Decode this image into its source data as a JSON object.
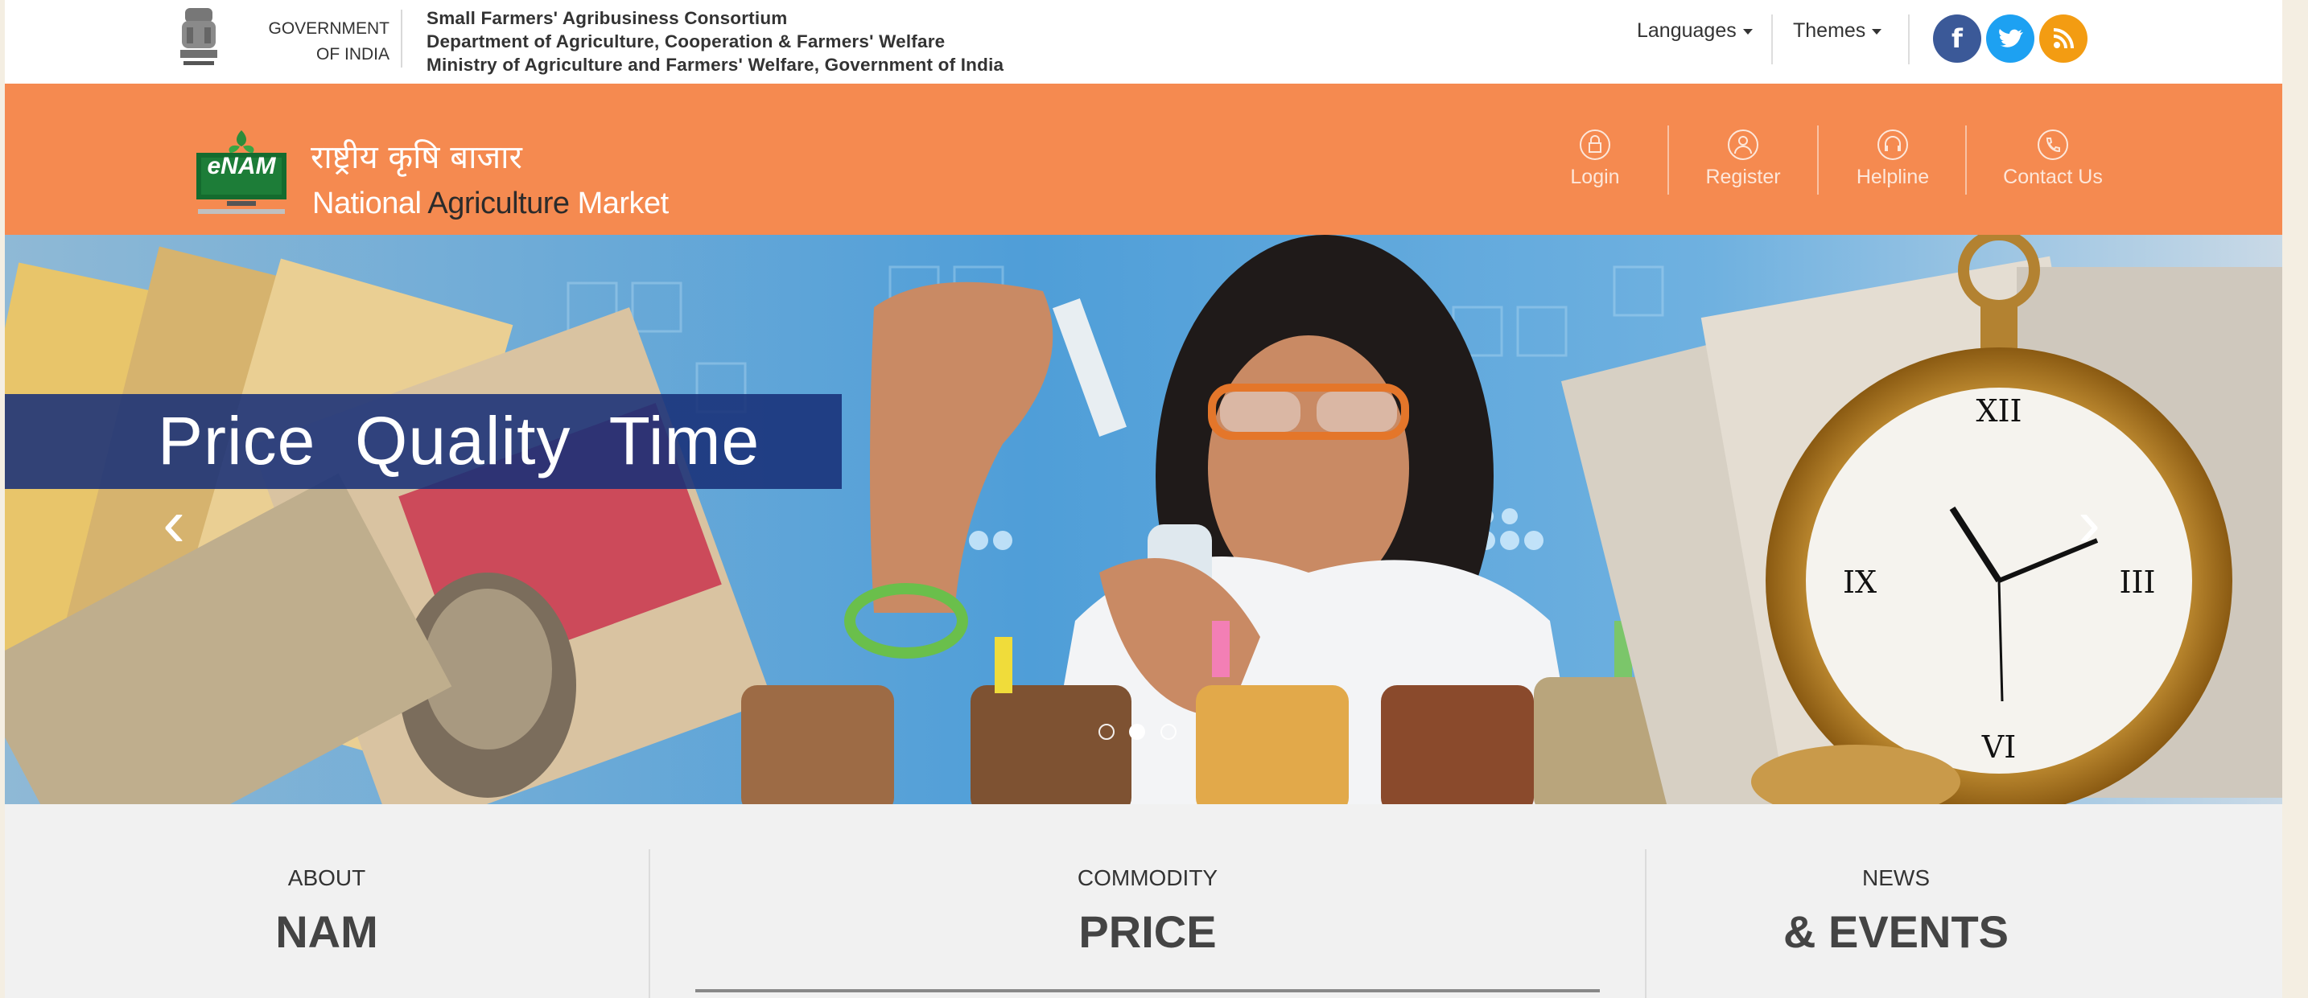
{
  "gov": {
    "line1": "GOVERNMENT",
    "line2": "OF INDIA",
    "consortium_l1": "Small Farmers' Agribusiness Consortium",
    "consortium_l2": "Department of Agriculture, Cooperation & Farmers' Welfare",
    "consortium_l3": "Ministry of Agriculture and Farmers' Welfare, Government of India",
    "emblem_icon": "national-emblem-icon"
  },
  "topnav": {
    "languages": "Languages",
    "themes": "Themes"
  },
  "social": {
    "facebook": "f",
    "twitter": "t",
    "rss": "rss"
  },
  "brand": {
    "logo_text": "eNAM",
    "name_hi": "राष्ट्रीय कृषि बाजार",
    "name_en_1": "National",
    "name_en_2": "Agriculture",
    "name_en_3": "Market"
  },
  "nav": {
    "login": "Login",
    "register": "Register",
    "helpline": "Helpline",
    "contact": "Contact Us"
  },
  "banner": {
    "caption": "Price  Quality  Time",
    "prev": "‹",
    "next": "›",
    "slides": 3,
    "active_slide": 2
  },
  "tiles": [
    {
      "small": "ABOUT",
      "big": "NAM"
    },
    {
      "small": "COMMODITY",
      "big": "PRICE"
    },
    {
      "small": "NEWS",
      "big": "& EVENTS"
    }
  ],
  "colors": {
    "orange": "#f58a50",
    "facebook": "#3b5998",
    "twitter": "#1da1f2",
    "rss": "#f39c12",
    "caption_band": "#18307a"
  }
}
